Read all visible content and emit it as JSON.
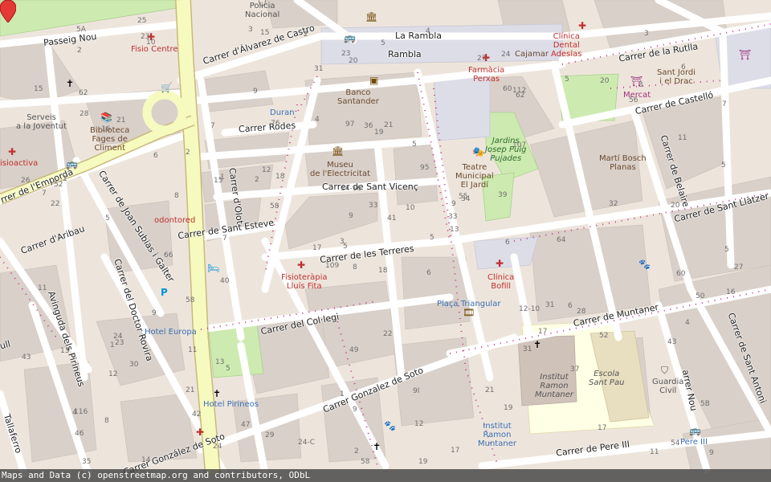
{
  "map": {
    "streets": [
      {
        "id": "passeig-nou",
        "text": "Passeig Nou"
      },
      {
        "id": "carrer-alvarez-castro",
        "text": "Carrer d'Álvarez de Castro"
      },
      {
        "id": "la-rambla",
        "text": "La Rambla"
      },
      {
        "id": "rambla",
        "text": "Rambla"
      },
      {
        "id": "carrer-rutlla",
        "text": "Carrer de la Rutlla"
      },
      {
        "id": "carrer-rodes",
        "text": "Carrer Rodes"
      },
      {
        "id": "carrer-castello",
        "text": "Carrer de Castelló"
      },
      {
        "id": "carrer-emporda",
        "text": "rrer de l'Empordà"
      },
      {
        "id": "carrer-sant-vicenc",
        "text": "Carrer de Sant Vicenç"
      },
      {
        "id": "carrer-olot",
        "text": "Carrer d'Olot"
      },
      {
        "id": "carrer-sant-esteve",
        "text": "Carrer de Sant Esteve"
      },
      {
        "id": "carrer-aribau",
        "text": "Carrer d'Aribau"
      },
      {
        "id": "carrer-joan-subias",
        "text": "Carrer de Joan Subias i Galter"
      },
      {
        "id": "carrer-terreres",
        "text": "Carrer de les Terreres"
      },
      {
        "id": "carrer-sant-llatzer",
        "text": "Carrer de Sant Llàtzer"
      },
      {
        "id": "carrer-belaire",
        "text": "Carrer de Belaire"
      },
      {
        "id": "carrer-doctor-rovira",
        "text": "Carrer del Doctor Rovira"
      },
      {
        "id": "avinguda-pirineus",
        "text": "Avinguda dels Pirineus"
      },
      {
        "id": "carrer-col-legi",
        "text": "Carrer del Col·legi"
      },
      {
        "id": "carrer-muntaner",
        "text": "Carrer de Muntaner"
      },
      {
        "id": "carrer-gonzalez-soto",
        "text": "Carrer Gonzalez de Soto"
      },
      {
        "id": "carrer-gonzalez-soto-2",
        "text": "Carrer González de Soto"
      },
      {
        "id": "carrer-sant-antoni",
        "text": "Carrer de Sant Antoni"
      },
      {
        "id": "carrer-nou",
        "text": "arrer Nou"
      },
      {
        "id": "carrer-pere-iii",
        "text": "Carrer de Pere III"
      },
      {
        "id": "tallaferro",
        "text": "Tallaferro"
      },
      {
        "id": "ull",
        "text": "ull"
      }
    ],
    "pois": [
      {
        "id": "policia-nacional",
        "text": "Policia\nNacional",
        "icon": "police"
      },
      {
        "id": "fisio-centre",
        "text": "Fisio Centre",
        "icon": "hospital"
      },
      {
        "id": "clinica-dental-adeslas",
        "text": "Clínica\nDental\nAdeslas",
        "icon": "hospital"
      },
      {
        "id": "cajamar",
        "text": "Cajamar",
        "icon": "bank"
      },
      {
        "id": "farmacia-perxas",
        "text": "Farmàcia\nPerxas",
        "icon": "pharmacy"
      },
      {
        "id": "banco-santander",
        "text": "Banco\nSantander",
        "icon": "bank"
      },
      {
        "id": "duran",
        "text": "Duran",
        "icon": "shop"
      },
      {
        "id": "serveis-juventut",
        "text": "Serveis\na la Joventut",
        "icon": "none"
      },
      {
        "id": "biblioteca",
        "text": "Biblioteca\nFages de\nCliment",
        "icon": "library"
      },
      {
        "id": "fisioactiva",
        "text": "isioactiva",
        "icon": "hospital"
      },
      {
        "id": "museu-electricitat",
        "text": "Museu\nde l'Electricitat",
        "icon": "museum"
      },
      {
        "id": "jardins-josep-puig",
        "text": "Jardins\nJosep Puig\nPujades",
        "icon": "none"
      },
      {
        "id": "teatre-municipal",
        "text": "Teatre\nMunicipal\nEl Jardí",
        "icon": "theatre"
      },
      {
        "id": "marti-bosch",
        "text": "Martí Bosch\nPlanas",
        "icon": "none"
      },
      {
        "id": "mercat",
        "text": "Mercat",
        "icon": "market"
      },
      {
        "id": "sant-jordi",
        "text": "Sant Jordi\ni el Drac",
        "icon": "none"
      },
      {
        "id": "odontored",
        "text": "odontored",
        "icon": "none"
      },
      {
        "id": "fisioterapia-lluis-fita",
        "text": "Fisioteràpia\nLluís Fita",
        "icon": "hospital"
      },
      {
        "id": "clinica-bofill",
        "text": "Clínica\nBofill",
        "icon": "hospital"
      },
      {
        "id": "placa-triangular",
        "text": "Plaça Triangular",
        "icon": "none"
      },
      {
        "id": "hotel-europa",
        "text": "Hotel Europa",
        "icon": "hotel"
      },
      {
        "id": "hotel-pirineos",
        "text": "Hotel Pirineos",
        "icon": "hotel"
      },
      {
        "id": "institut-ramon-muntaner",
        "text": "Institut\nRamon\nMuntaner",
        "icon": "none"
      },
      {
        "id": "escola-sant-pau",
        "text": "Escola\nSant Pau",
        "icon": "none"
      },
      {
        "id": "guardia-civil",
        "text": "Guardia\nCivil",
        "icon": "none"
      },
      {
        "id": "institut-ramon-muntaner-2",
        "text": "Institut\nRamon\nMuntaner",
        "icon": "none"
      },
      {
        "id": "pere-iii-stop",
        "text": "Pere III",
        "icon": "bus"
      }
    ],
    "house_numbers": [
      "18",
      "16",
      "5",
      "116",
      "9",
      "5",
      "24",
      "21",
      "112",
      "5",
      "10",
      "9",
      "5",
      "7",
      "109",
      "107",
      "14",
      "97",
      "95",
      "30",
      "18",
      "46",
      "42",
      "36",
      "34",
      "28",
      "21",
      "20",
      "22",
      "12-10",
      "5",
      "3",
      "1",
      "9",
      "7",
      "5",
      "13",
      "11",
      "5B",
      "6",
      "4",
      "2",
      "8",
      "31",
      "24",
      "26",
      "33",
      "35",
      "9",
      "13",
      "12",
      "11",
      "15",
      "17",
      "19",
      "21",
      "23",
      "5A",
      "9I",
      "3",
      "5",
      "7",
      "1",
      "2",
      "20",
      "25",
      "27",
      "31",
      "33",
      "43",
      "49",
      "29",
      "31",
      "15",
      "4",
      "2",
      "6",
      "11",
      "14-16",
      "12",
      "10",
      "8",
      "6",
      "4",
      "2",
      "20",
      "22",
      "17",
      "19",
      "21",
      "23",
      "27",
      "39",
      "37",
      "41",
      "43",
      "52",
      "58",
      "60",
      "62",
      "66",
      "3",
      "5",
      "7",
      "9",
      "11",
      "47",
      "55",
      "56",
      "58",
      "60",
      "62",
      "19",
      "17",
      "15",
      "13",
      "8",
      "6",
      "4",
      "2",
      "1",
      "3",
      "5",
      "76",
      "64",
      "58",
      "54",
      "24-C",
      "32",
      "28",
      "23",
      "17",
      "1",
      "9",
      "50",
      "52",
      "40",
      "24",
      "16",
      "12",
      "6"
    ],
    "attribution": "Maps and Data (c) openstreetmap.org and contributors, ODbL",
    "colors": {
      "background": "#ede5dc",
      "road_major": "#f7fabf",
      "road": "#ffffff",
      "building": "#d9d0c9",
      "park": "#cdebb0",
      "school": "#ffffe5",
      "pedestrian": "#dddde8",
      "marker": "#e53935",
      "poi_red": "#c03030",
      "poi_brown": "#734a08",
      "poi_blue": "#0092da"
    }
  }
}
